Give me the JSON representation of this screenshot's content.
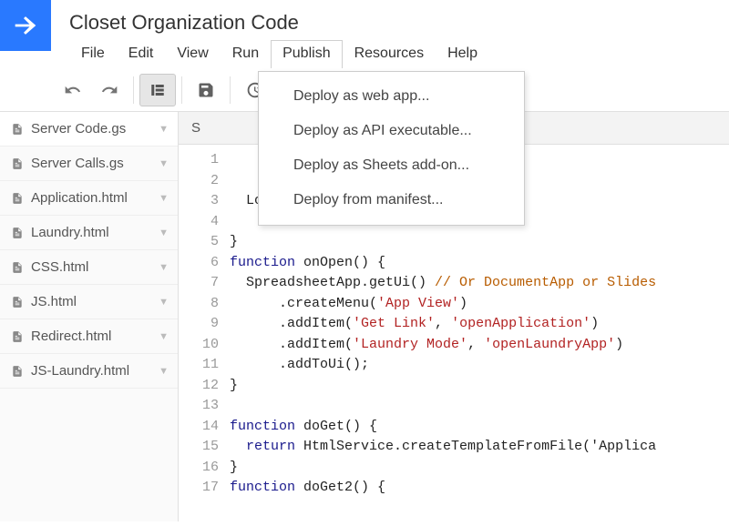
{
  "header": {
    "title": "Closet Organization Code",
    "menus": [
      "File",
      "Edit",
      "View",
      "Run",
      "Publish",
      "Resources",
      "Help"
    ],
    "open_menu_index": 4,
    "dropdown_items": [
      "Deploy as web app...",
      "Deploy as API executable...",
      "Deploy as Sheets add-on...",
      "Deploy from manifest..."
    ]
  },
  "toolbar": {
    "undo": "undo-icon",
    "redo": "redo-icon",
    "sidebar_toggle": "sidebar-toggle-icon",
    "save": "save-icon",
    "history": "history-icon"
  },
  "sidebar": {
    "files": [
      {
        "name": "Server Code.gs",
        "active": true
      },
      {
        "name": "Server Calls.gs",
        "active": false
      },
      {
        "name": "Application.html",
        "active": false
      },
      {
        "name": "Laundry.html",
        "active": false
      },
      {
        "name": "CSS.html",
        "active": false
      },
      {
        "name": "JS.html",
        "active": false
      },
      {
        "name": "Redirect.html",
        "active": false
      },
      {
        "name": "JS-Laundry.html",
        "active": false
      }
    ]
  },
  "editor": {
    "tab_label": "S",
    "first_line": 1,
    "last_line": 17,
    "code_lines": [
      "",
      "",
      "  Logger.log(e);",
      "",
      "}",
      "function onOpen() {",
      "  SpreadsheetApp.getUi() // Or DocumentApp or Slides",
      "      .createMenu('App View')",
      "      .addItem('Get Link', 'openApplication')",
      "      .addItem('Laundry Mode', 'openLaundryApp')",
      "      .addToUi();",
      "}",
      "",
      "function doGet() {",
      "  return HtmlService.createTemplateFromFile('Applica",
      "}",
      "function doGet2() {"
    ]
  }
}
